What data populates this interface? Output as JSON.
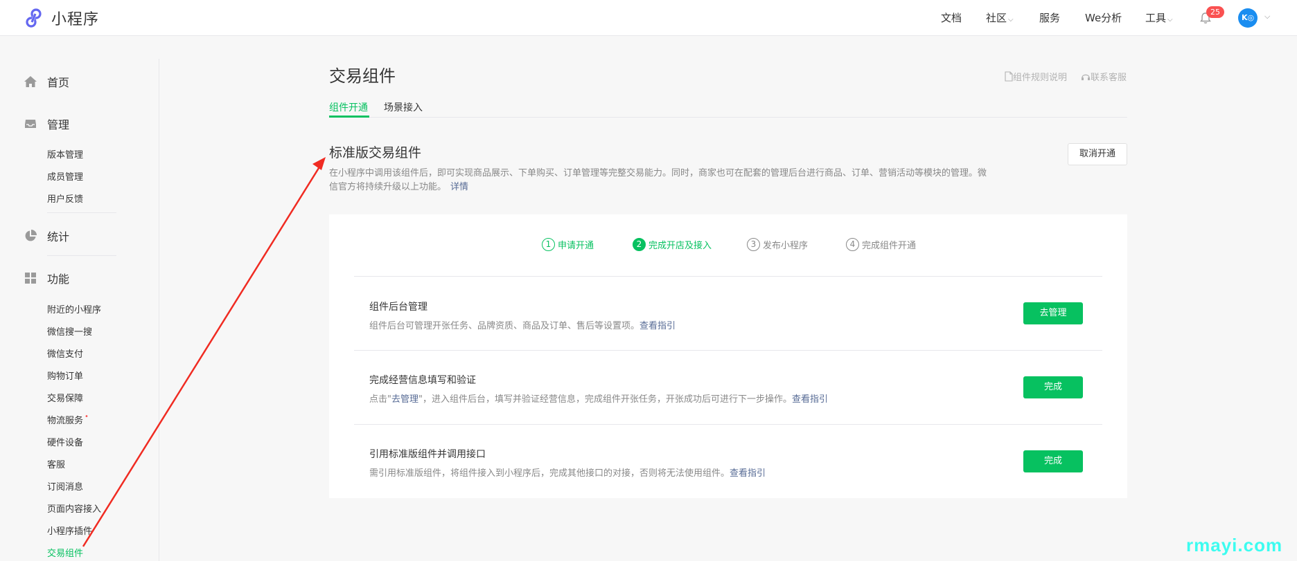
{
  "app": {
    "logo_text": "小程序",
    "brand_color": "#6467f0"
  },
  "topnav": {
    "items": [
      {
        "label": "文档",
        "has_dropdown": false
      },
      {
        "label": "社区",
        "has_dropdown": true
      },
      {
        "label": "服务",
        "has_dropdown": false
      },
      {
        "label": "We分析",
        "has_dropdown": false
      },
      {
        "label": "工具",
        "has_dropdown": true
      }
    ],
    "notification_count": "25",
    "avatar_text": "K◎"
  },
  "sidebar": {
    "sections": [
      {
        "label": "首页",
        "icon": "home-icon"
      },
      {
        "label": "管理",
        "icon": "inbox-icon",
        "items": [
          "版本管理",
          "成员管理",
          "用户反馈"
        ]
      },
      {
        "label": "统计",
        "icon": "pie-chart-icon"
      },
      {
        "label": "功能",
        "icon": "grid-icon",
        "items": [
          "附近的小程序",
          "微信搜一搜",
          "微信支付",
          "购物订单",
          "交易保障",
          "物流服务",
          "硬件设备",
          "客服",
          "订阅消息",
          "页面内容接入",
          "小程序插件",
          "交易组件"
        ]
      }
    ],
    "active_item": "交易组件",
    "dotted_item": "物流服务"
  },
  "main": {
    "title": "交易组件",
    "links": {
      "rules": "组件规则说明",
      "support": "联系客服"
    },
    "tabs": [
      {
        "label": "组件开通",
        "active": true
      },
      {
        "label": "场景接入",
        "active": false
      }
    ],
    "section_title": "标准版交易组件",
    "section_desc": "在小程序中调用该组件后，即可实现商品展示、下单购买、订单管理等完整交易能力。同时，商家也可在配套的管理后台进行商品、订单、营销活动等模块的管理。微信官方将持续升级以上功能。",
    "section_desc_link": "详情",
    "cancel_label": "取消开通",
    "steps": [
      {
        "num": "1",
        "label": "申请开通",
        "state": "done"
      },
      {
        "num": "2",
        "label": "完成开店及接入",
        "state": "current"
      },
      {
        "num": "3",
        "label": "发布小程序",
        "state": "todo"
      },
      {
        "num": "4",
        "label": "完成组件开通",
        "state": "todo"
      }
    ],
    "tasks": [
      {
        "title": "组件后台管理",
        "desc": "组件后台可管理开张任务、品牌资质、商品及订单、售后等设置项。",
        "link": "查看指引",
        "button": "去管理"
      },
      {
        "title": "完成经营信息填写和验证",
        "desc_prefix": "点击\"",
        "desc_quote": "去管理",
        "desc": "\"，进入组件后台，填写并验证经营信息，完成组件开张任务，开张成功后可进行下一步操作。",
        "link": "查看指引",
        "button": "完成"
      },
      {
        "title": "引用标准版组件并调用接口",
        "desc": "需引用标准版组件，将组件接入到小程序后，完成其他接口的对接，否则将无法使用组件。",
        "link": "查看指引",
        "button": "完成"
      }
    ]
  },
  "colors": {
    "accent_green": "#07c160",
    "link_blue": "#576b95",
    "badge_red": "#fa5151",
    "annotation_arrow": "#f02b22",
    "watermark": "#3dfcf0"
  },
  "watermark_text": "rmayi.com"
}
